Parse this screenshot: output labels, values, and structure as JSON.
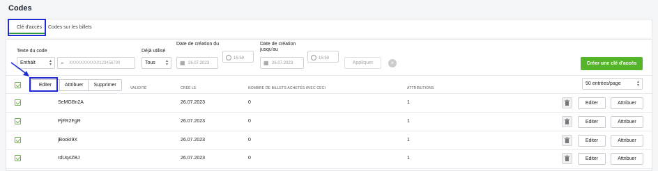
{
  "page": {
    "title": "Codes"
  },
  "tabs": [
    {
      "label": "Clé d'accès",
      "active": true
    },
    {
      "label": "Codes sur les billets",
      "active": false
    }
  ],
  "filters": {
    "code_text_label": "Texte du code",
    "match_mode": "Enthält",
    "code_placeholder": "XXXXXXXXXX0123456790",
    "used_label": "Déjà utilisé",
    "used_value": "Tous",
    "created_from_label": "Date de création du",
    "created_from_date": "26.07.2023",
    "created_from_time": "15:59",
    "created_to_label": "Date de création jusqu'au",
    "created_to_date": "26.07.2023",
    "created_to_time": "15:59",
    "apply_label": "Appliquer",
    "clear_label": "×"
  },
  "create_button": "Créer une clé d'accès",
  "bulk_actions": [
    "Editer",
    "Attribuer",
    "Supprimer"
  ],
  "columns": [
    "VALIDITÉ",
    "CRÉÉ LE",
    "NOMBRE DE BILLETS ACHETÉS AVEC CECI",
    "ATTRIBUTIONS"
  ],
  "per_page": "50 entrées/page",
  "rows": [
    {
      "code": "SeMGBn2A",
      "created": "26.07.2023",
      "tickets": "0",
      "attributions": "1"
    },
    {
      "code": "PjFR2FgR",
      "created": "26.07.2023",
      "tickets": "0",
      "attributions": "1"
    },
    {
      "code": "jBookI9X",
      "created": "26.07.2023",
      "tickets": "0",
      "attributions": "1"
    },
    {
      "code": "rdUq4ZBJ",
      "created": "26.07.2023",
      "tickets": "0",
      "attributions": "1"
    }
  ],
  "row_actions": {
    "edit": "Editer",
    "assign": "Attribuer"
  },
  "colors": {
    "accent": "#54b52a",
    "annotation": "#1e2bd6",
    "checkbox": "#6fb24b"
  }
}
